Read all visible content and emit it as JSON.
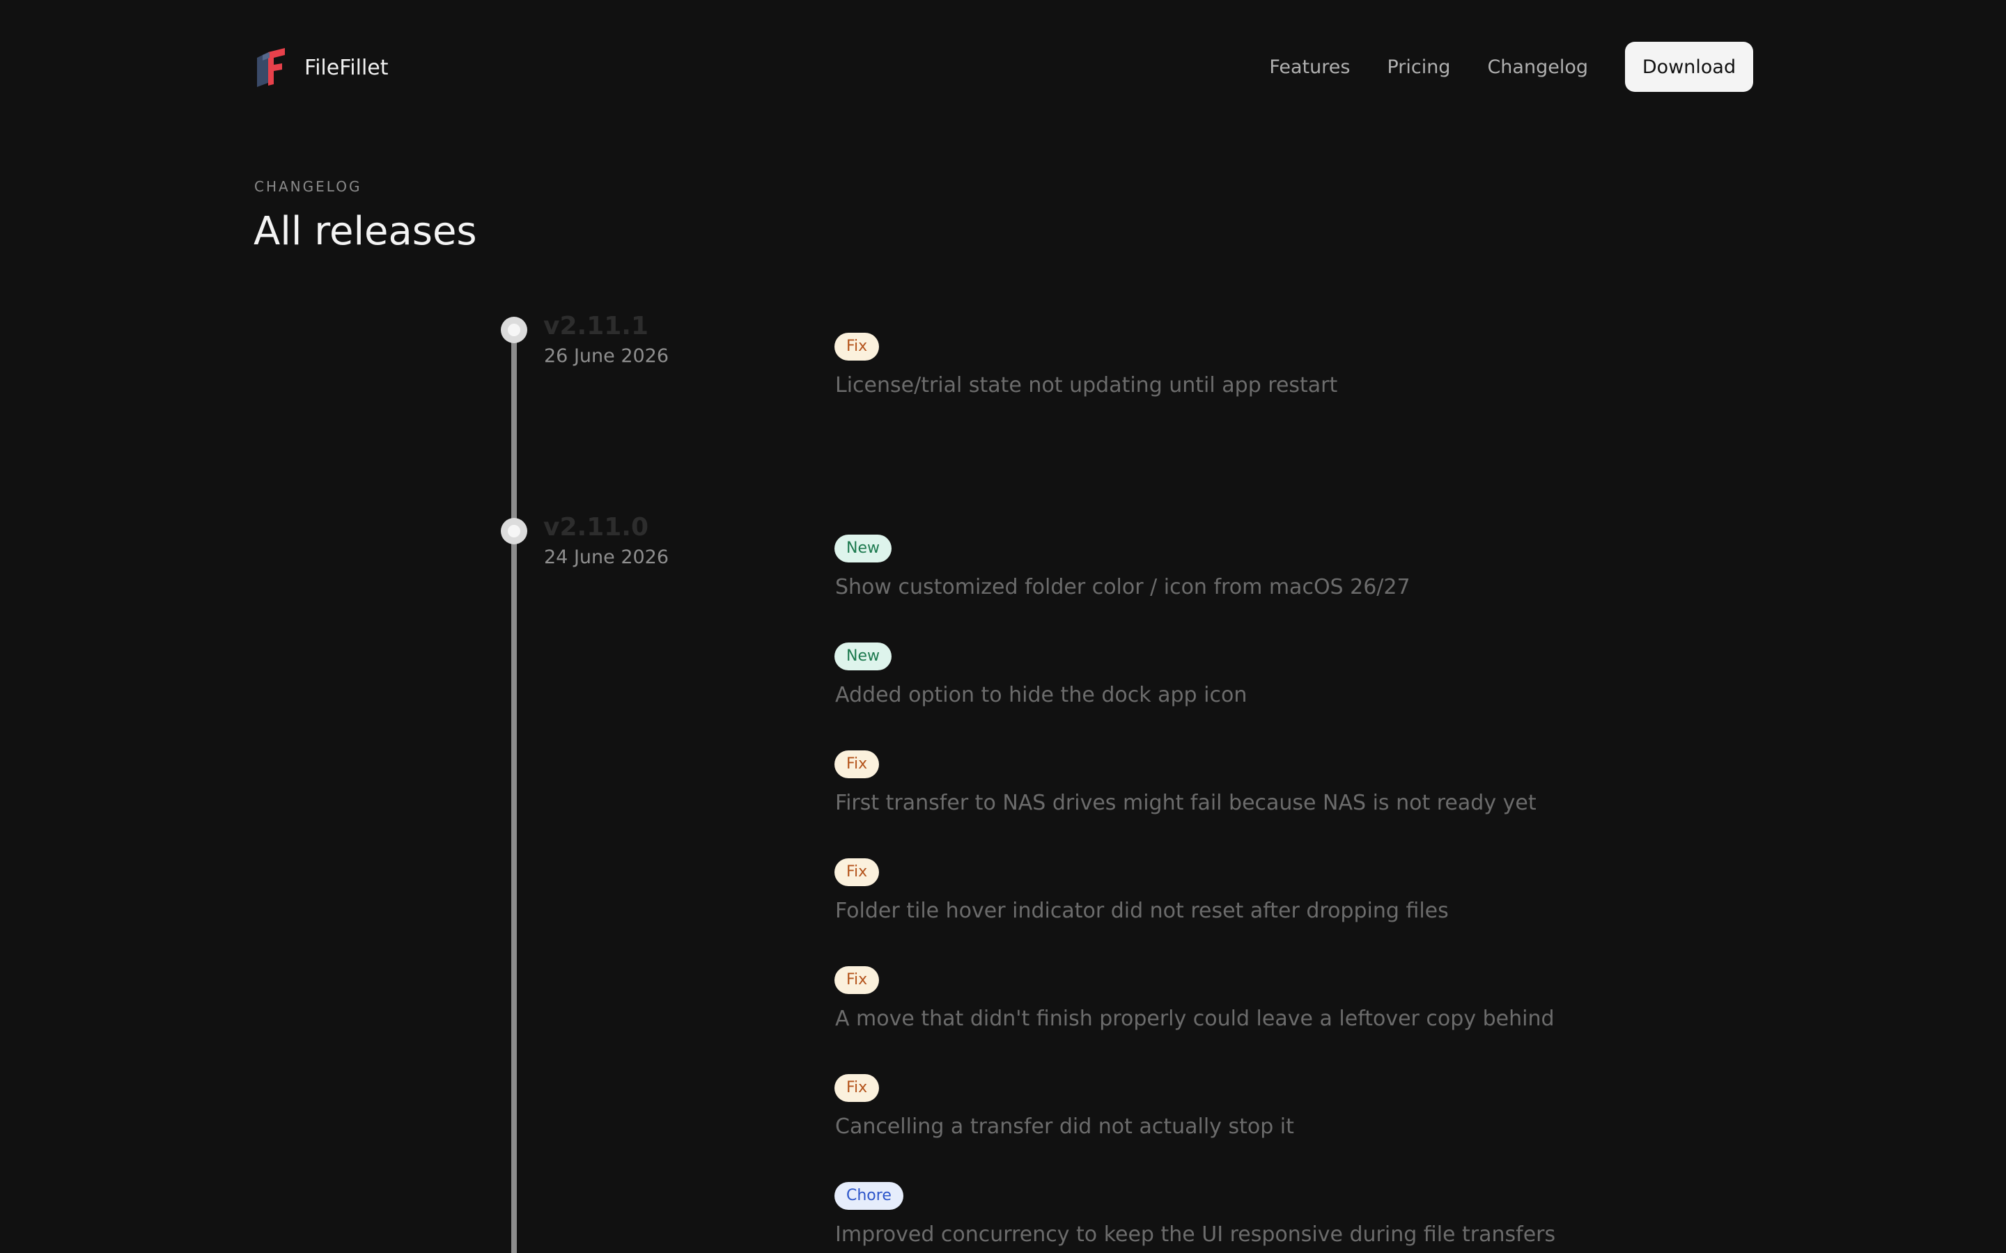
{
  "header": {
    "brand": "FileFillet",
    "nav": [
      "Features",
      "Pricing",
      "Changelog"
    ],
    "download_label": "Download"
  },
  "hero": {
    "eyebrow": "CHANGELOG",
    "title": "All releases"
  },
  "colors": {
    "background": "#111111",
    "fix_badge_bg": "#fbf1dd",
    "fix_badge_text": "#b4541c",
    "new_badge_bg": "#def4ec",
    "new_badge_text": "#1d7a4f",
    "chore_badge_bg": "#e6edfb",
    "chore_badge_text": "#2c55c9",
    "logo_red": "#e8414b",
    "logo_navy": "#3a4a68"
  },
  "releases": [
    {
      "version": "v2.11.1",
      "date": "26 June 2026",
      "entries": [
        {
          "type": "Fix",
          "text": "License/trial state not updating until app restart"
        }
      ]
    },
    {
      "version": "v2.11.0",
      "date": "24 June 2026",
      "entries": [
        {
          "type": "New",
          "text": "Show customized folder color / icon from macOS 26/27"
        },
        {
          "type": "New",
          "text": "Added option to hide the dock app icon"
        },
        {
          "type": "Fix",
          "text": "First transfer to NAS drives might fail because NAS is not ready yet"
        },
        {
          "type": "Fix",
          "text": "Folder tile hover indicator did not reset after dropping files"
        },
        {
          "type": "Fix",
          "text": "A move that didn't finish properly could leave a leftover copy behind"
        },
        {
          "type": "Fix",
          "text": "Cancelling a transfer did not actually stop it"
        },
        {
          "type": "Chore",
          "text": "Improved concurrency to keep the UI responsive during file transfers"
        }
      ]
    }
  ]
}
